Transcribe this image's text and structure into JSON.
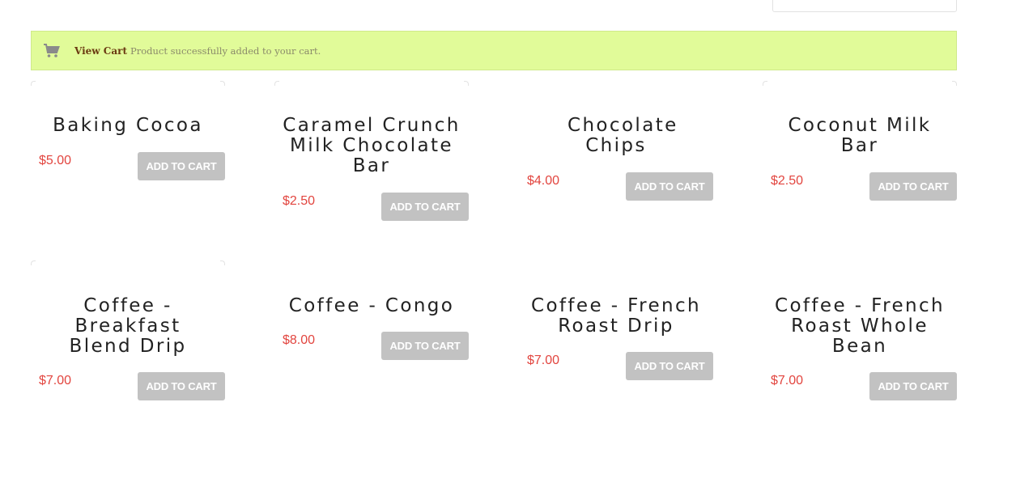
{
  "notice": {
    "link_label": "View Cart",
    "message": "Product successfully added to your cart.",
    "icon": "cart-icon"
  },
  "products": [
    {
      "name": "Baking Cocoa",
      "price": "$5.00",
      "button": "ADD TO CART"
    },
    {
      "name": "Caramel Crunch Milk Chocolate Bar",
      "price": "$2.50",
      "button": "ADD TO CART"
    },
    {
      "name": "Chocolate Chips",
      "price": "$4.00",
      "button": "ADD TO CART"
    },
    {
      "name": "Coconut Milk Bar",
      "price": "$2.50",
      "button": "ADD TO CART"
    },
    {
      "name": "Coffee - Breakfast Blend Drip",
      "price": "$7.00",
      "button": "ADD TO CART"
    },
    {
      "name": "Coffee - Congo",
      "price": "$8.00",
      "button": "ADD TO CART"
    },
    {
      "name": "Coffee - French Roast Drip",
      "price": "$7.00",
      "button": "ADD TO CART"
    },
    {
      "name": "Coffee - French Roast Whole Bean",
      "price": "$7.00",
      "button": "ADD TO CART"
    }
  ],
  "colors": {
    "notice_bg": "#e1fb99",
    "price": "#e2453f",
    "button_bg": "#c2c2c2",
    "link": "#6b3a12"
  }
}
